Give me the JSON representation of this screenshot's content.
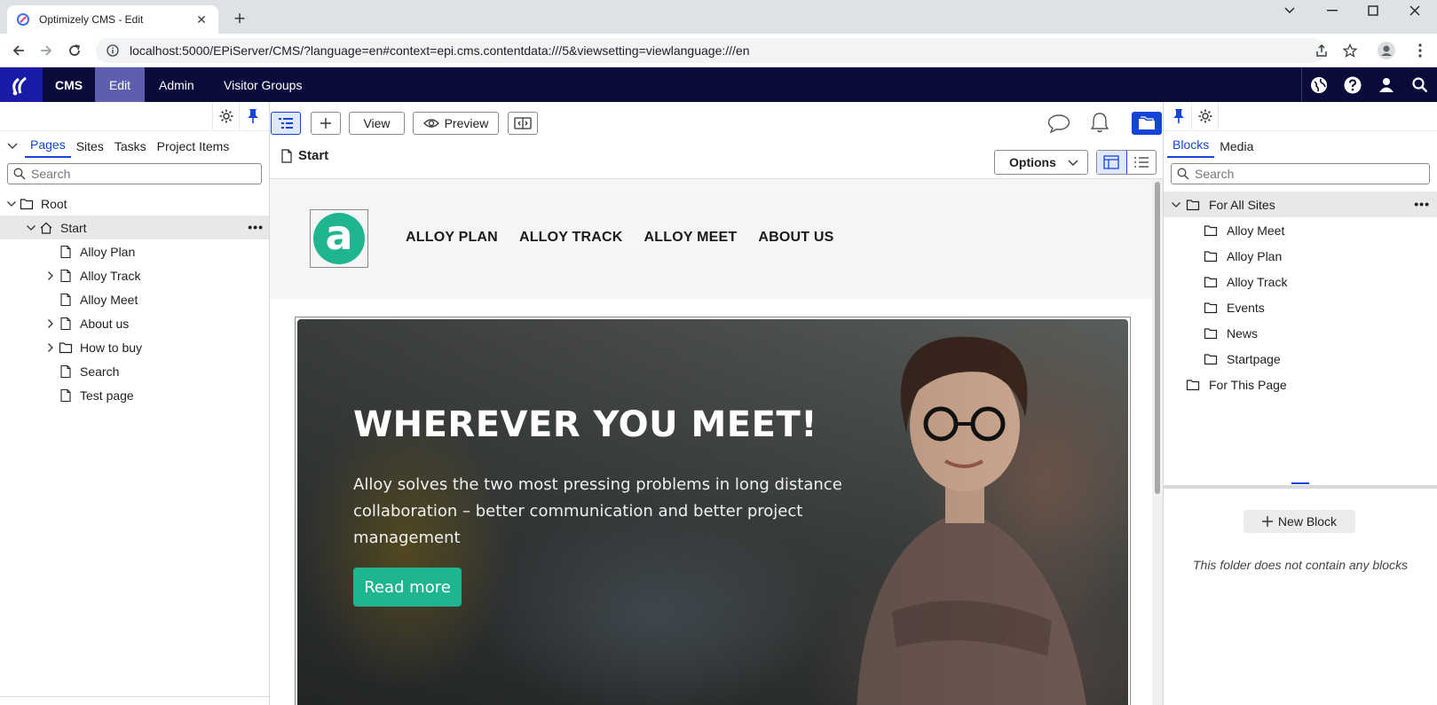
{
  "browser": {
    "tab_title": "Optimizely CMS - Edit",
    "url": "localhost:5000/EPiServer/CMS/?language=en#context=epi.cms.contentdata:///5&viewsetting=viewlanguage:///en"
  },
  "cms_nav": {
    "brand": "CMS",
    "items": [
      {
        "label": "Edit",
        "active": true
      },
      {
        "label": "Admin",
        "active": false
      },
      {
        "label": "Visitor Groups",
        "active": false
      }
    ]
  },
  "left_pane": {
    "tabs": [
      {
        "label": "Pages",
        "active": true
      },
      {
        "label": "Sites",
        "active": false
      },
      {
        "label": "Tasks",
        "active": false
      },
      {
        "label": "Project Items",
        "active": false
      }
    ],
    "search_placeholder": "Search",
    "tree": [
      {
        "label": "Root",
        "icon": "folder-icon",
        "indent": 0,
        "expander": "expanded"
      },
      {
        "label": "Start",
        "icon": "home-icon",
        "indent": 1,
        "expander": "expanded",
        "selected": true
      },
      {
        "label": "Alloy Plan",
        "icon": "page-icon",
        "indent": 2,
        "expander": "none"
      },
      {
        "label": "Alloy Track",
        "icon": "page-icon",
        "indent": 2,
        "expander": "collapsed"
      },
      {
        "label": "Alloy Meet",
        "icon": "page-icon",
        "indent": 2,
        "expander": "none"
      },
      {
        "label": "About us",
        "icon": "page-icon",
        "indent": 2,
        "expander": "collapsed"
      },
      {
        "label": "How to buy",
        "icon": "folder-icon",
        "indent": 2,
        "expander": "collapsed"
      },
      {
        "label": "Search",
        "icon": "page-icon",
        "indent": 2,
        "expander": "none"
      },
      {
        "label": "Test page",
        "icon": "page-icon",
        "indent": 2,
        "expander": "none"
      }
    ]
  },
  "center": {
    "toolbar": {
      "view_label": "View",
      "preview_label": "Preview"
    },
    "page_name": "Start",
    "options_label": "Options"
  },
  "site": {
    "logo_letter": "a",
    "menu": [
      "ALLOY PLAN",
      "ALLOY TRACK",
      "ALLOY MEET",
      "ABOUT US"
    ],
    "hero_title": "WHEREVER YOU MEET!",
    "hero_text": "Alloy solves the two most pressing problems in long distance collaboration – better communication and better project management",
    "hero_button": "Read more"
  },
  "right_pane": {
    "tabs": [
      {
        "label": "Blocks",
        "active": true
      },
      {
        "label": "Media",
        "active": false
      }
    ],
    "search_placeholder": "Search",
    "tree": [
      {
        "label": "For All Sites",
        "indent": 0,
        "expander": "expanded",
        "selected": true
      },
      {
        "label": "Alloy Meet",
        "indent": 1,
        "expander": "none"
      },
      {
        "label": "Alloy Plan",
        "indent": 1,
        "expander": "none"
      },
      {
        "label": "Alloy Track",
        "indent": 1,
        "expander": "none"
      },
      {
        "label": "Events",
        "indent": 1,
        "expander": "none"
      },
      {
        "label": "News",
        "indent": 1,
        "expander": "none"
      },
      {
        "label": "Startpage",
        "indent": 1,
        "expander": "none"
      },
      {
        "label": "For This Page",
        "indent": 0,
        "expander": "none"
      }
    ],
    "new_block_label": "New Block",
    "empty_message": "This folder does not contain any blocks"
  },
  "colors": {
    "cms_nav_bg": "#0b0b3b",
    "active_nav": "#5e5eb0",
    "accent_blue": "#1544d8",
    "alloy_green": "#1fb591"
  }
}
